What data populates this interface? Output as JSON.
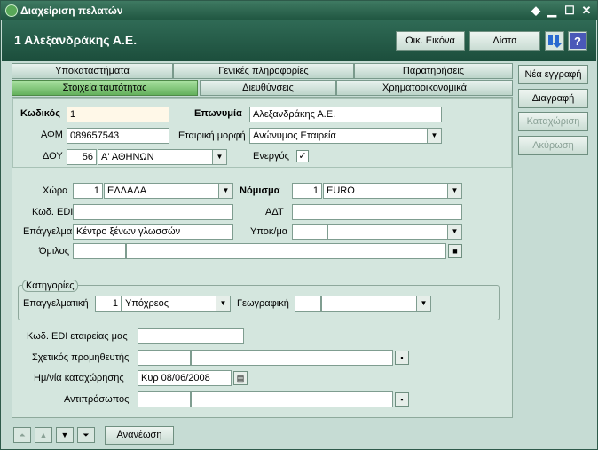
{
  "window": {
    "title": "Διαχείριση πελατών"
  },
  "header": {
    "record_title": "1 Αλεξανδράκης Α.Ε.",
    "btn_family": "Οικ. Εικόνα",
    "btn_list": "Λίστα"
  },
  "tabs": {
    "row1": [
      "Υποκαταστήματα",
      "Γενικές πληροφορίες",
      "Παρατηρήσεις"
    ],
    "row2": [
      "Στοιχεία ταυτότητας",
      "Διευθύνσεις",
      "Χρηματοοικονομικά"
    ]
  },
  "identity": {
    "code_label": "Κωδικός",
    "code_value": "1",
    "name_label": "Επωνυμία",
    "name_value": "Αλεξανδράκης Α.Ε.",
    "afm_label": "ΑΦΜ",
    "afm_value": "089657543",
    "corp_form_label": "Εταιρική μορφή",
    "corp_form_value": "Ανώνυμος Εταιρεία",
    "doy_label": "ΔΟΥ",
    "doy_code": "56",
    "doy_value": "Α' ΑΘΗΝΩΝ",
    "active_label": "Ενεργός",
    "active_check": "✓"
  },
  "general": {
    "country_label": "Χώρα",
    "country_code": "1",
    "country_value": "ΕΛΛΑΔΑ",
    "currency_label": "Νόμισμα",
    "currency_code": "1",
    "currency_value": "EURO",
    "edi_label": "Κωδ. EDI",
    "adt_label": "ΑΔΤ",
    "profession_label": "Επάγγελμα",
    "profession_value": "Κέντρο ξένων γλωσσών",
    "subcat_label": "Υποκ/μα",
    "group_label": "Όμιλος"
  },
  "categories": {
    "title": "Κατηγορίες",
    "prof_label": "Επαγγελματική",
    "prof_code": "1",
    "prof_value": "Υπόχρεος",
    "geo_label": "Γεωγραφική"
  },
  "extra": {
    "company_edi_label": "Κωδ. EDI εταιρείας μας",
    "supplier_label": "Σχετικός προμηθευτής",
    "reg_date_label": "Ημ/νία καταχώρησης",
    "reg_date_value": "Κυρ 08/06/2008",
    "rep_label": "Αντιπρόσωπος"
  },
  "side": {
    "new": "Νέα εγγραφή",
    "delete": "Διαγραφή",
    "save": "Καταχώριση",
    "cancel": "Ακύρωση"
  },
  "bottom": {
    "refresh": "Ανανέωση"
  }
}
